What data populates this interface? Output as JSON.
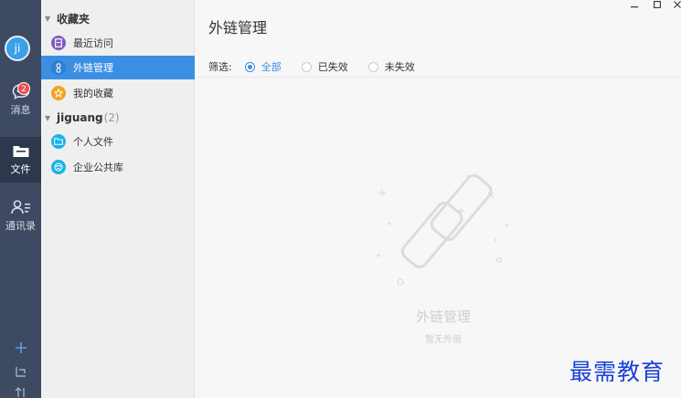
{
  "rail": {
    "avatar_text": "ji",
    "items": [
      {
        "label": "消息",
        "badge": "2"
      },
      {
        "label": "文件"
      },
      {
        "label": "通讯录"
      }
    ]
  },
  "tree": {
    "favorites_title": "收藏夹",
    "favorites": [
      {
        "label": "最近访问",
        "icon": "recent-doc-icon",
        "color": "#7d5cc0"
      },
      {
        "label": "外链管理",
        "icon": "link-icon",
        "color": "#3b8fe3"
      },
      {
        "label": "我的收藏",
        "icon": "star-icon",
        "color": "#f3a31b"
      }
    ],
    "workspace_title": "jiguang",
    "workspace_count": "(2)",
    "workspace": [
      {
        "label": "个人文件",
        "icon": "personal-folder-icon",
        "color": "#1ab3e6"
      },
      {
        "label": "企业公共库",
        "icon": "enterprise-library-icon",
        "color": "#1ab3e6"
      }
    ]
  },
  "main": {
    "title": "外链管理",
    "filter_label": "筛选:",
    "filters": [
      {
        "label": "全部",
        "checked": true
      },
      {
        "label": "已失效",
        "checked": false
      },
      {
        "label": "未失效",
        "checked": false
      }
    ],
    "empty_title": "外链管理",
    "empty_sub": "暂无外链"
  },
  "watermark": "最需教育",
  "colors": {
    "accent": "#3b8fe3",
    "rail": "#3d4a61",
    "badge": "#ee4d4d"
  }
}
